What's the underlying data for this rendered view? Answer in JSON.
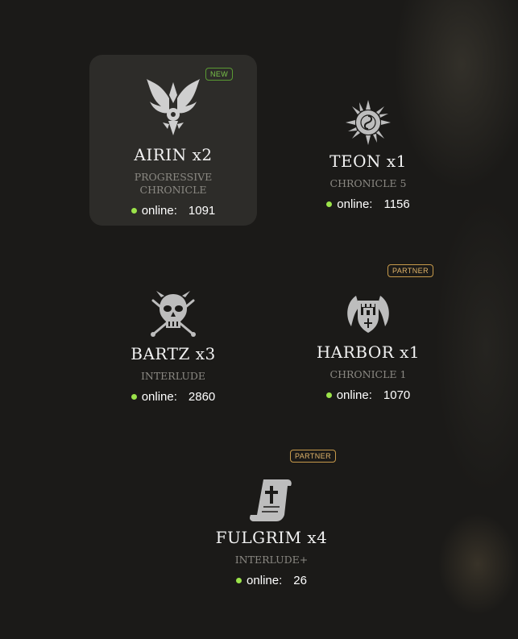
{
  "servers": [
    {
      "name": "AIRIN x2",
      "chronicle_line1": "PROGRESSIVE",
      "chronicle_line2": "CHRONICLE",
      "online_label": "online:",
      "online_count": "1091",
      "badge": "NEW",
      "emblem": "winged-crest-icon"
    },
    {
      "name": "TEON x1",
      "chronicle": "CHRONICLE 5",
      "online_label": "online:",
      "online_count": "1156",
      "emblem": "sun-sigil-icon"
    },
    {
      "name": "BARTZ x3",
      "chronicle": "INTERLUDE",
      "online_label": "online:",
      "online_count": "2860",
      "emblem": "skull-maces-icon"
    },
    {
      "name": "HARBOR x1",
      "chronicle": "CHRONICLE 1",
      "online_label": "online:",
      "online_count": "1070",
      "badge": "PARTNER",
      "emblem": "castle-shield-icon"
    },
    {
      "name": "FULGRIM x4",
      "chronicle": "INTERLUDE+",
      "online_label": "online:",
      "online_count": "26",
      "badge": "PARTNER",
      "emblem": "scroll-icon"
    }
  ],
  "colors": {
    "online_dot": "#9be34a",
    "new_badge": "#79c34a",
    "partner_badge": "#e0b46a",
    "card_active": "#2d2c29"
  }
}
